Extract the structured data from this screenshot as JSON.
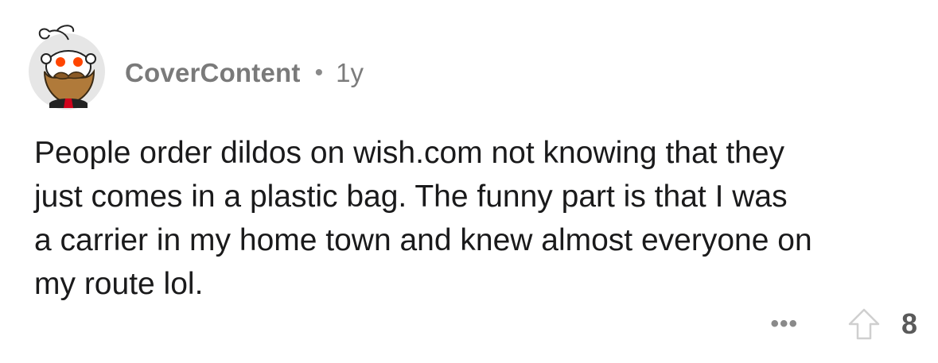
{
  "comment": {
    "username": "CoverContent",
    "separator": "•",
    "age": "1y",
    "body": "People order dildos on wish.com not knowing that they\njust comes in a plastic bag. The funny part is that I was\na carrier in my home town and knew almost everyone on\nmy route lol.",
    "more_label": "•••",
    "score": "8"
  },
  "icons": {
    "avatar": "snoo-avatar-icon",
    "upvote": "upvote-arrow-icon"
  },
  "colors": {
    "text": "#1a1a1b",
    "meta": "#7c7c7c",
    "avatar_bg": "#e8e8e8",
    "avatar_eyes": "#ff4500",
    "avatar_beard": "#b07a3a"
  }
}
